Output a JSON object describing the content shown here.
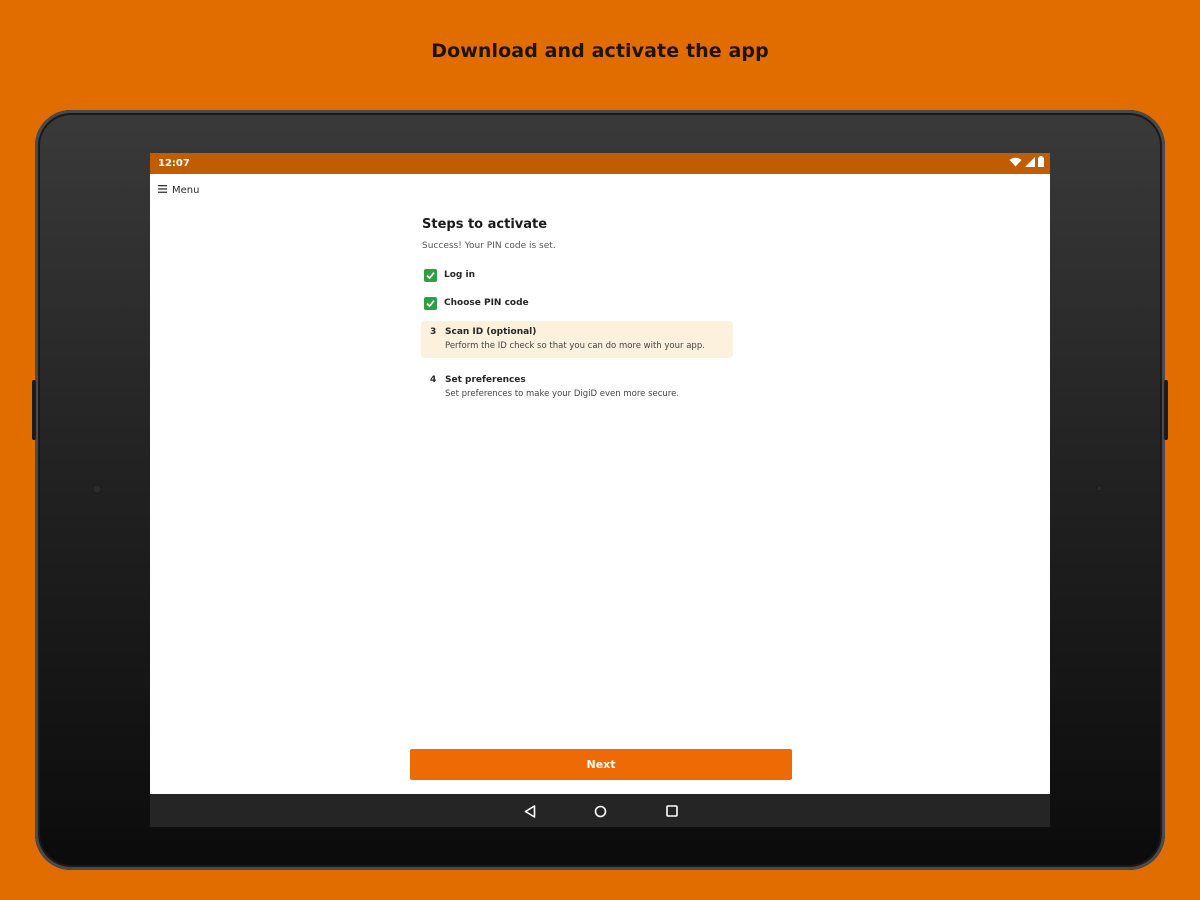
{
  "headline": "Download and activate the app",
  "status_bar": {
    "time": "12:07",
    "icons": [
      "wifi-icon",
      "signal-icon",
      "battery-icon"
    ]
  },
  "app_bar": {
    "menu_icon": "hamburger-menu-icon",
    "menu_label": "Menu"
  },
  "main": {
    "title": "Steps to activate",
    "subtitle": "Success! Your PIN code is set.",
    "steps": [
      {
        "label": "Log in",
        "status": "completed",
        "icon": "checkbox-checked-icon"
      },
      {
        "label": "Choose PIN code",
        "status": "completed",
        "icon": "checkbox-checked-icon"
      },
      {
        "number": "3",
        "label": "Scan ID (optional)",
        "description": "Perform the ID check so that you can do more with your app.",
        "status": "current"
      },
      {
        "number": "4",
        "label": "Set preferences",
        "description": "Set preferences to make your DigiD even more secure.",
        "status": "pending"
      }
    ],
    "next_label": "Next"
  },
  "nav_bar": {
    "icons": [
      "back-icon",
      "home-icon",
      "recents-icon"
    ]
  },
  "colors": {
    "background": "#e16d00",
    "status_bar": "#c15c00",
    "accent": "#ee6a05",
    "check": "#2f9e44",
    "current_step_highlight": "#fcf1dc",
    "nav_bar": "#252525"
  }
}
